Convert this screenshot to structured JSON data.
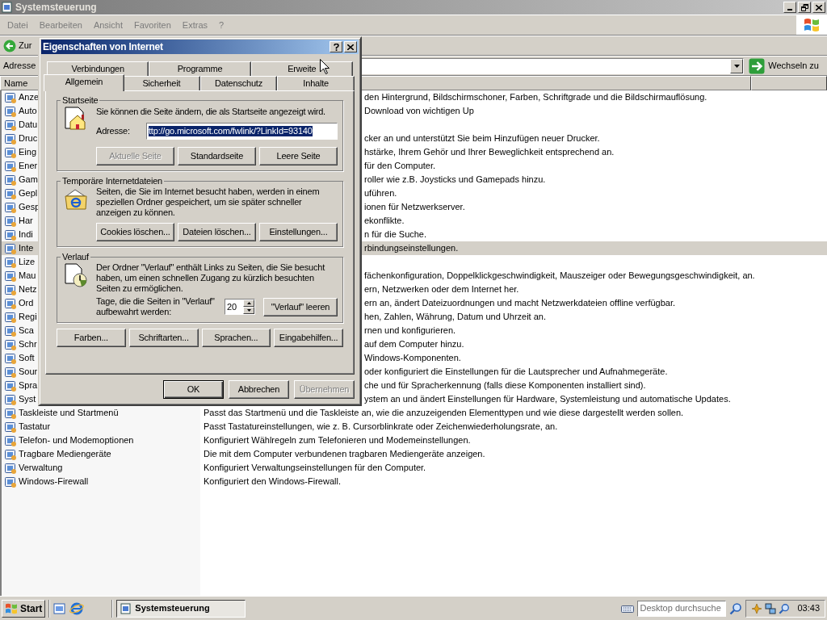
{
  "window": {
    "title": "Systemsteuerung"
  },
  "menu": [
    "Datei",
    "Bearbeiten",
    "Ansicht",
    "Favoriten",
    "Extras",
    "?"
  ],
  "toolbar": {
    "back": "Zur"
  },
  "address_bar": {
    "label": "Adresse",
    "go": "Wechseln zu"
  },
  "list": {
    "columns": [
      "Name"
    ],
    "rows": [
      {
        "name": "Anze",
        "description": "den Hintergrund, Bildschirmschoner, Farben, Schriftgrade und die Bildschirmauflösung.",
        "selected": false
      },
      {
        "name": "Auto",
        "description": "Download von wichtigen Up",
        "selected": false
      },
      {
        "name": "Datu",
        "selected": false
      },
      {
        "name": "Druc",
        "description": "cker an und unterstützt Sie beim Hinzufügen neuer Drucker.",
        "selected": false
      },
      {
        "name": "Eing",
        "description": "hstärke, Ihrem Gehör und Ihrer Beweglichkeit entsprechend an.",
        "selected": false
      },
      {
        "name": "Ener",
        "description": "für den Computer.",
        "selected": false
      },
      {
        "name": "Gam",
        "description": "roller wie z.B. Joysticks und Gamepads hinzu.",
        "selected": false
      },
      {
        "name": "Gepl",
        "description": "uführen.",
        "selected": false
      },
      {
        "name": "Gesp",
        "description": "ionen für Netzwerkserver.",
        "selected": false
      },
      {
        "name": "Har",
        "description": "ekonflikte.",
        "selected": false
      },
      {
        "name": "Indi",
        "description": "n für die Suche.",
        "selected": false
      },
      {
        "name": "Inte",
        "description": "rbindungseinstellungen.",
        "selected": true
      },
      {
        "name": "Lize",
        "selected": false
      },
      {
        "name": "Mau",
        "description": "fächenkonfiguration, Doppelklickgeschwindigkeit, Mauszeiger oder Bewegungsgeschwindigkeit, an.",
        "selected": false
      },
      {
        "name": "Netz",
        "description": "ern, Netzwerken oder dem Internet her.",
        "selected": false
      },
      {
        "name": "Ord",
        "description": "ern an, ändert Dateizuordnungen und macht Netzwerkdateien offline verfügbar.",
        "selected": false
      },
      {
        "name": "Regi",
        "description": "hen, Zahlen, Währung, Datum und Uhrzeit an.",
        "selected": false
      },
      {
        "name": "Sca",
        "description": "rnen und konfigurieren.",
        "selected": false
      },
      {
        "name": "Schr",
        "description": "auf dem Computer hinzu.",
        "selected": false
      },
      {
        "name": "Soft",
        "description": "Windows-Komponenten.",
        "selected": false
      },
      {
        "name": "Sour",
        "description": "oder konfiguriert die Einstellungen für die Lautsprecher und Aufnahmegeräte.",
        "selected": false
      },
      {
        "name": "Spra",
        "description": "che und für Spracherkennung (falls diese Komponenten installiert sind).",
        "selected": false
      },
      {
        "name": "Syst",
        "description": "ystem an und ändert Einstellungen für Hardware, Systemleistung und automatische Updates.",
        "selected": false
      },
      {
        "name": "Taskleiste und Startmenü",
        "description": "Passt das Startmenü und die Taskleiste an, wie die anzuzeigenden Elementtypen und wie diese dargestellt werden sollen.",
        "selected": false
      },
      {
        "name": "Tastatur",
        "description": "Passt Tastatureinstellungen, wie z. B. Cursorblinkrate oder Zeichenwiederholungsrate, an.",
        "selected": false
      },
      {
        "name": "Telefon- und Modemoptionen",
        "description": "Konfiguriert Wählregeln zum Telefonieren und Modemeinstellungen.",
        "selected": false
      },
      {
        "name": "Tragbare Mediengeräte",
        "description": "Die mit dem Computer verbundenen tragbaren Mediengeräte anzeigen.",
        "selected": false
      },
      {
        "name": "Verwaltung",
        "description": "Konfiguriert Verwaltungseinstellungen für den Computer.",
        "selected": false
      },
      {
        "name": "Windows-Firewall",
        "description": "Konfiguriert den Windows-Firewall.",
        "selected": false
      }
    ]
  },
  "dialog": {
    "title": "Eigenschaften von Internet",
    "tab_rows": [
      [
        {
          "label": "Verbindungen",
          "selected": false
        },
        {
          "label": "Programme",
          "selected": false
        },
        {
          "label": "Erweite",
          "selected": false
        }
      ],
      [
        {
          "label": "Allgemein",
          "selected": true
        },
        {
          "label": "Sicherheit",
          "selected": false
        },
        {
          "label": "Datenschutz",
          "selected": false
        },
        {
          "label": "Inhalte",
          "selected": false
        }
      ]
    ],
    "home_page": {
      "title": "Startseite",
      "text": "Sie können die Seite ändern, die als Startseite angezeigt wird.",
      "address_label": "Adresse:",
      "address_value": "ttp://go.microsoft.com/fwlink/?LinkId=93140",
      "buttons": [
        {
          "label": "Aktuelle Seite",
          "disabled": true
        },
        {
          "label": "Standardseite",
          "disabled": false
        },
        {
          "label": "Leere Seite",
          "disabled": false
        }
      ]
    },
    "temp_files": {
      "title": "Temporäre Internetdateien",
      "text": "Seiten, die Sie im Internet besucht haben, werden in einem speziellen Ordner gespeichert, um sie später schneller anzeigen zu können.",
      "buttons": [
        {
          "label": "Cookies löschen...",
          "disabled": false
        },
        {
          "label": "Dateien löschen...",
          "disabled": false
        },
        {
          "label": "Einstellungen...",
          "disabled": false
        }
      ]
    },
    "history": {
      "title": "Verlauf",
      "text": "Der Ordner \"Verlauf\" enthält Links zu Seiten, die Sie besucht haben, um einen schnellen Zugang zu kürzlich besuchten Seiten zu ermöglichen.",
      "days_label": "Tage, die die Seiten in \"Verlauf\" aufbewahrt werden:",
      "days": "20",
      "buttons": [
        {
          "label": "\"Verlauf\" leeren",
          "disabled": false
        }
      ]
    },
    "extra_buttons": [
      {
        "label": "Farben...",
        "disabled": false
      },
      {
        "label": "Schriftarten...",
        "disabled": false
      },
      {
        "label": "Sprachen...",
        "disabled": false
      },
      {
        "label": "Eingabehilfen...",
        "disabled": false
      }
    ],
    "footer_buttons": [
      {
        "label": "OK",
        "disabled": false,
        "default": true
      },
      {
        "label": "Abbrechen",
        "disabled": false,
        "default": false
      },
      {
        "label": "Übernehmen",
        "disabled": true,
        "default": false
      }
    ]
  },
  "taskbar": {
    "start": "Start",
    "tasks": [
      {
        "label": "Systemsteuerung",
        "selected": true
      }
    ],
    "search": {
      "placeholder": "Desktop durchsuche"
    },
    "clock": "03:43"
  }
}
